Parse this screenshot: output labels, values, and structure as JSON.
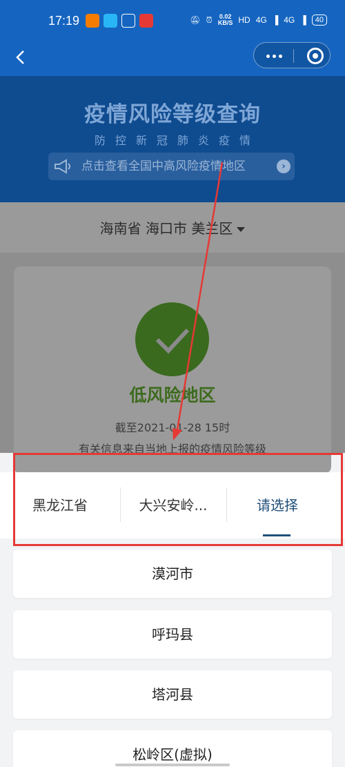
{
  "status_bar": {
    "time": "17:19",
    "speed_value": "0.02",
    "speed_unit": "KB/S",
    "hd": "HD",
    "net1": "4G",
    "net2": "4G",
    "battery": "40"
  },
  "banner": {
    "title": "疫情风险等级查询",
    "subtitle": "防控新冠肺炎疫情",
    "notice": "点击查看全国中高风险疫情地区"
  },
  "region": {
    "label": "海南省 海口市 美兰区"
  },
  "risk": {
    "level": "低风险地区",
    "as_of": "截至2021-01-28 15时",
    "note": "有关信息来自当地上报的疫情风险等级"
  },
  "picker": {
    "tabs": [
      {
        "label": "黑龙江省"
      },
      {
        "label": "大兴安岭..."
      },
      {
        "label": "请选择"
      }
    ],
    "options": [
      {
        "label": "漠河市"
      },
      {
        "label": "呼玛县"
      },
      {
        "label": "塔河县"
      },
      {
        "label": "松岭区(虚拟)"
      }
    ]
  },
  "colors": {
    "header_blue": "#1565c0",
    "active_tab": "#1f4e79",
    "annotation_red": "#e53935",
    "low_risk_green": "#3d6b1d"
  }
}
